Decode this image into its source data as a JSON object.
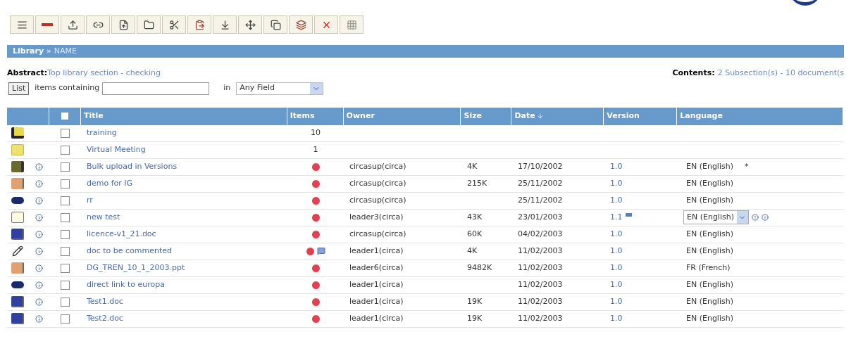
{
  "toolbar": [
    {
      "kind": "lines"
    },
    {
      "kind": "remove"
    },
    {
      "kind": "upload"
    },
    {
      "kind": "link"
    },
    {
      "kind": "import"
    },
    {
      "kind": "folder"
    },
    {
      "kind": "cut"
    },
    {
      "kind": "paste"
    },
    {
      "kind": "down"
    },
    {
      "kind": "move"
    },
    {
      "kind": "copy"
    },
    {
      "kind": "stack"
    },
    {
      "kind": "delete"
    },
    {
      "kind": "grid"
    }
  ],
  "breadcrumb": [
    {
      "label": "Library"
    },
    {
      "label": "NAME"
    }
  ],
  "breadcrumb_separator": "»",
  "abstract": {
    "label": "Abstract:",
    "value": "Top library section - checking"
  },
  "contents": {
    "label": "Contents:",
    "value": "2 Subsection(s) - 10 document(s"
  },
  "search": {
    "button": "List",
    "label": "items containing",
    "in_label": "in",
    "field": "Any Field"
  },
  "select_all_checked": false,
  "columns": [
    {
      "label": "Title"
    },
    {
      "label": "Items"
    },
    {
      "label": "Owner"
    },
    {
      "label": "Size"
    },
    {
      "label": "Date",
      "sorted": true
    },
    {
      "label": "Version"
    },
    {
      "label": "Language"
    }
  ],
  "rows": [
    {
      "kind": "folder-shared",
      "title": "training",
      "items": "10",
      "checked": false
    },
    {
      "kind": "folder",
      "title": "Virtual Meeting",
      "items": "1",
      "checked": false
    },
    {
      "kind": "upload",
      "title": "Bulk upload in Versions",
      "comments": false,
      "owner": "circasup(circa)",
      "size": "4K",
      "date": "17/10/2002",
      "version": "1.0",
      "version_flag": false,
      "language": "EN (English)",
      "language_mark": "*",
      "editable": false,
      "checked": false
    },
    {
      "kind": "slides",
      "title": "demo for IG",
      "comments": false,
      "owner": "circasup(circa)",
      "size": "215K",
      "date": "25/11/2002",
      "version": "1.0",
      "version_flag": false,
      "language": "EN (English)",
      "editable": false,
      "checked": false
    },
    {
      "kind": "link",
      "title": "rr",
      "comments": false,
      "owner": "circasup(circa)",
      "date": "25/11/2002",
      "version": "1.0",
      "version_flag": false,
      "language": "EN (English)",
      "editable": false,
      "checked": false
    },
    {
      "kind": "text",
      "title": "new test",
      "comments": false,
      "owner": "leader3(circa)",
      "size": "43K",
      "date": "23/01/2003",
      "version": "1.1",
      "version_flag": true,
      "language": "EN (English)",
      "editable": true,
      "checked": false
    },
    {
      "kind": "word",
      "title": "licence-v1_21.doc",
      "comments": false,
      "owner": "circasup(circa)",
      "size": "60K",
      "date": "04/02/2003",
      "version": "1.0",
      "version_flag": false,
      "language": "EN (English)",
      "editable": false,
      "checked": false
    },
    {
      "kind": "comment",
      "title": "doc to be commented",
      "comments": true,
      "owner": "leader1(circa)",
      "size": "4K",
      "date": "11/02/2003",
      "version": "1.0",
      "version_flag": false,
      "language": "EN (English)",
      "editable": false,
      "checked": false
    },
    {
      "kind": "slides",
      "title": "DG_TREN_10_1_2003.ppt",
      "comments": false,
      "owner": "leader6(circa)",
      "size": "9482K",
      "date": "11/02/2003",
      "version": "1.0",
      "version_flag": false,
      "language": "FR (French)",
      "editable": false,
      "checked": false
    },
    {
      "kind": "link",
      "title": "direct link to europa",
      "comments": false,
      "owner": "leader1(circa)",
      "date": "11/02/2003",
      "version": "1.0",
      "version_flag": false,
      "language": "EN (English)",
      "editable": false,
      "checked": false
    },
    {
      "kind": "word",
      "title": "Test1.doc",
      "comments": false,
      "owner": "leader1(circa)",
      "size": "19K",
      "date": "11/02/2003",
      "version": "1.0",
      "version_flag": false,
      "language": "EN (English)",
      "editable": false,
      "checked": false
    },
    {
      "kind": "word",
      "title": "Test2.doc",
      "comments": false,
      "owner": "leader1(circa)",
      "size": "19K",
      "date": "11/02/2003",
      "version": "1.0",
      "version_flag": false,
      "language": "EN (English)",
      "editable": false,
      "checked": false
    }
  ]
}
